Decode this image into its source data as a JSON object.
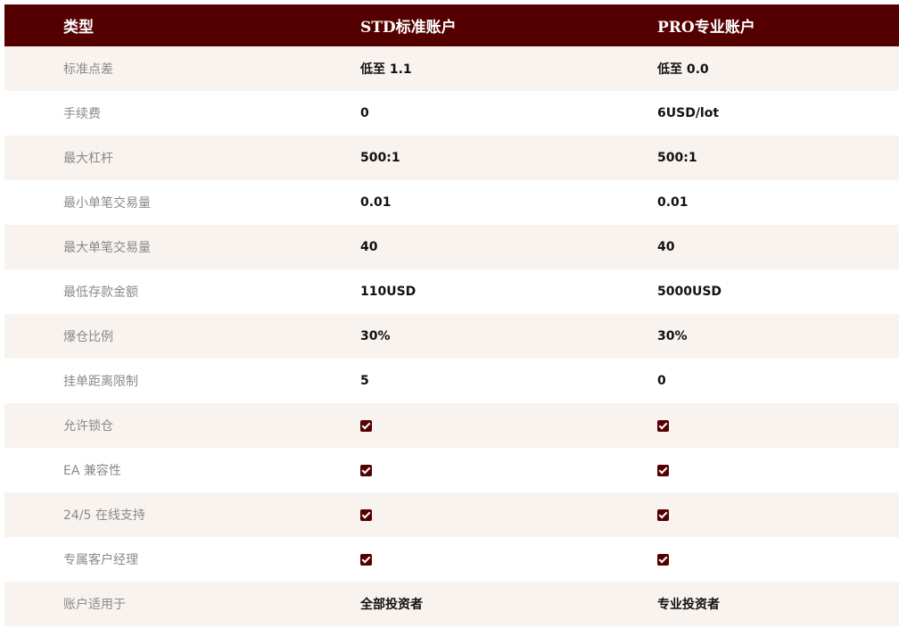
{
  "colors": {
    "header_bg": "#550000",
    "header_text": "#ffffff",
    "row_alt_bg": "#f8f3ef",
    "row_bg": "#ffffff",
    "label_text": "#8a8a8a",
    "value_text": "#111111",
    "check_fill": "#550000"
  },
  "table": {
    "headers": [
      "类型",
      "STD标准账户",
      "PRO专业账户"
    ],
    "rows": [
      {
        "label": "标准点差",
        "std": "低至 1.1",
        "pro": "低至 0.0"
      },
      {
        "label": "手续费",
        "std": "0",
        "pro": "6USD/lot"
      },
      {
        "label": "最大杠杆",
        "std": "500:1",
        "pro": "500:1"
      },
      {
        "label": "最小单笔交易量",
        "std": "0.01",
        "pro": "0.01"
      },
      {
        "label": "最大单笔交易量",
        "std": "40",
        "pro": "40"
      },
      {
        "label": "最低存款金额",
        "std": "110USD",
        "pro": "5000USD"
      },
      {
        "label": "爆仓比例",
        "std": "30%",
        "pro": "30%"
      },
      {
        "label": "挂单距离限制",
        "std": "5",
        "pro": "0"
      },
      {
        "label": "允许锁仓",
        "std_icon": "check-icon",
        "pro_icon": "check-icon"
      },
      {
        "label": "EA 兼容性",
        "std_icon": "check-icon",
        "pro_icon": "check-icon"
      },
      {
        "label": "24/5 在线支持",
        "std_icon": "check-icon",
        "pro_icon": "check-icon"
      },
      {
        "label": "专属客户经理",
        "std_icon": "check-icon",
        "pro_icon": "check-icon"
      },
      {
        "label": "账户适用于",
        "std": "全部投资者",
        "pro": "专业投资者"
      }
    ]
  }
}
